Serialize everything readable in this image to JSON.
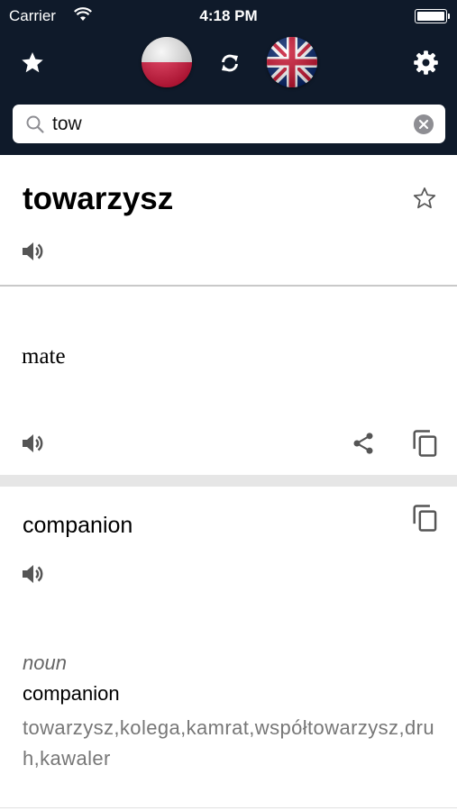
{
  "status_bar": {
    "carrier": "Carrier",
    "time": "4:18 PM"
  },
  "header": {
    "favorites_icon": "star-icon",
    "source_flag": "poland-flag",
    "swap_icon": "refresh-icon",
    "target_flag": "uk-flag",
    "settings_icon": "gear-icon",
    "background_color": "#0f1a2a"
  },
  "search": {
    "value": "tow"
  },
  "entry": {
    "word": "towarzysz"
  },
  "translation_card": {
    "text": "mate"
  },
  "definition_card": {
    "term": "companion",
    "part_of_speech": "noun",
    "definition_term": "companion",
    "synonyms": "towarzysz,kolega,kamrat,współtowarzysz,druh,kawaler"
  },
  "colors": {
    "divider": "#c9c9c9",
    "band": "#e6e6e6",
    "icon_gray": "#555555"
  }
}
